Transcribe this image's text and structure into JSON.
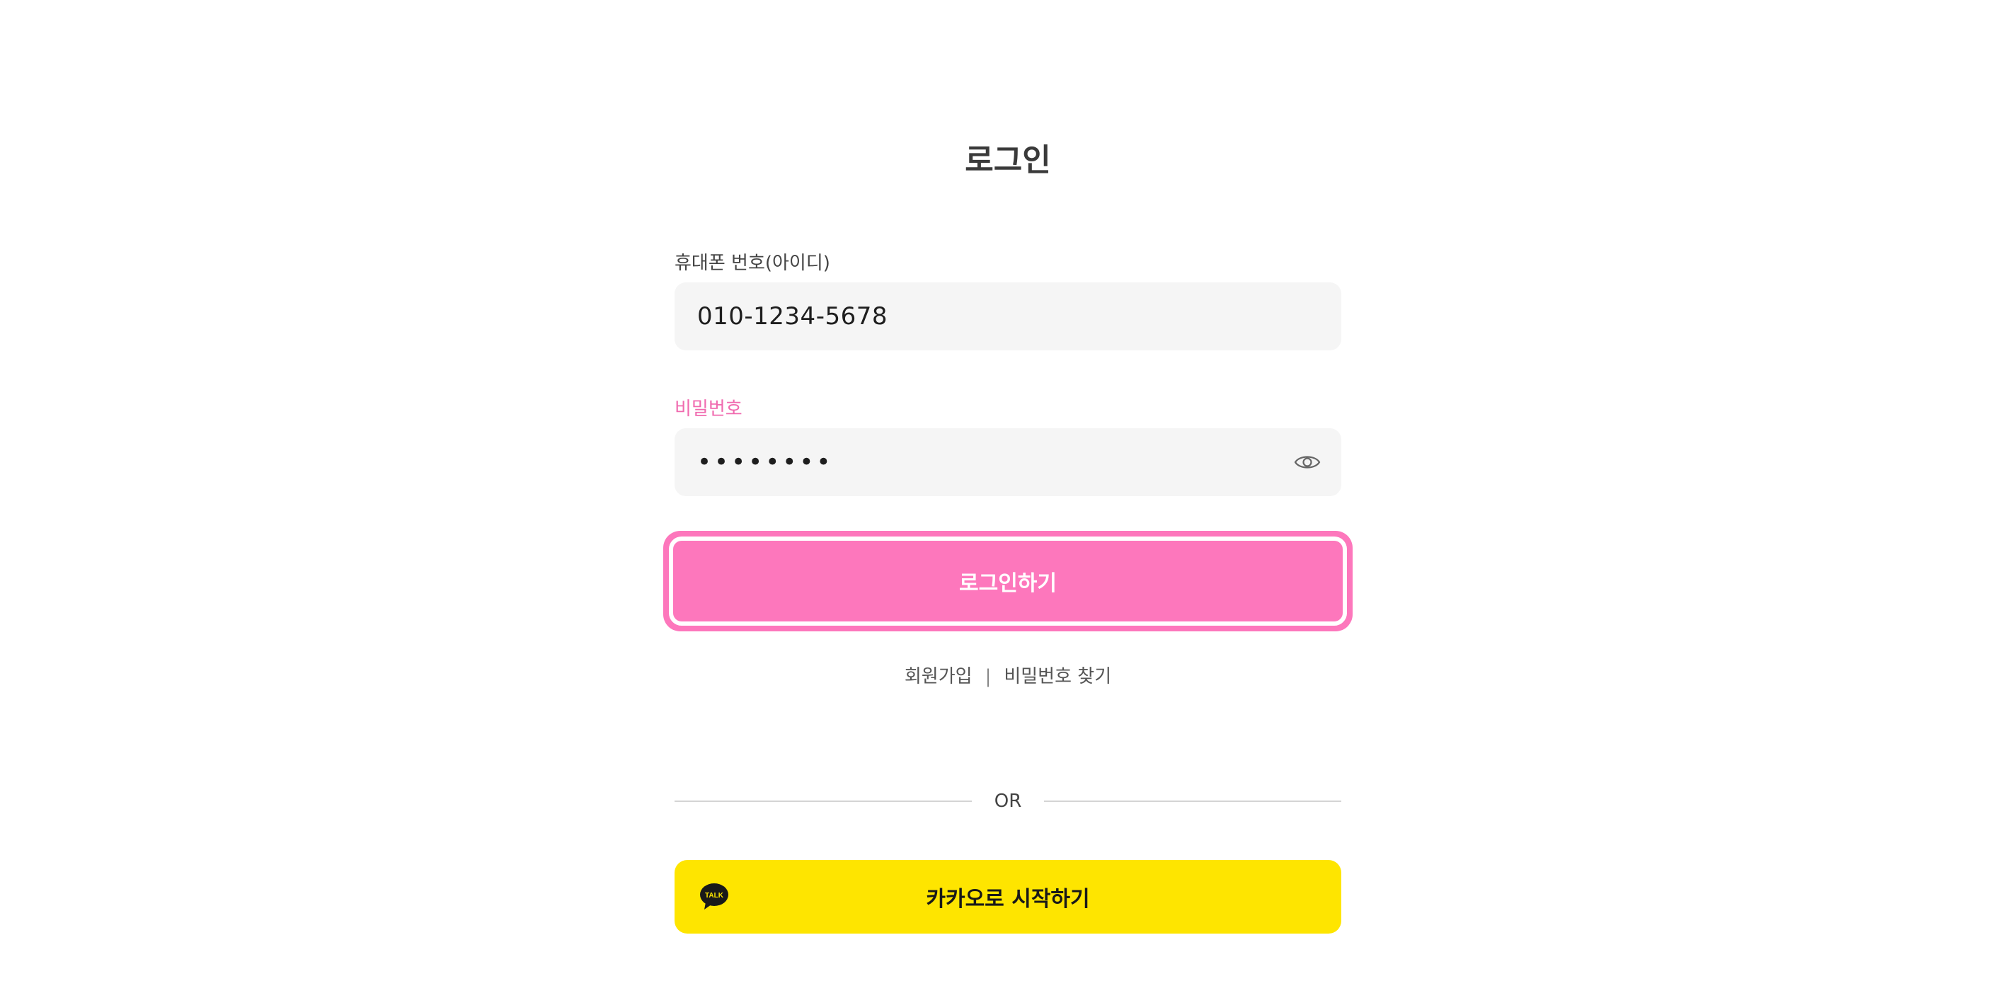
{
  "page_title": "로그인",
  "phone_field": {
    "label": "휴대폰 번호(아이디)",
    "value": "010-1234-5678"
  },
  "password_field": {
    "label": "비밀번호",
    "masked_value": "••••••••"
  },
  "login_button": {
    "label": "로그인하기"
  },
  "links": {
    "signup": "회원가입",
    "separator": "|",
    "find_password": "비밀번호 찾기"
  },
  "divider": {
    "text": "OR"
  },
  "kakao_button": {
    "label": "카카오로 시작하기",
    "icon_text": "TALK"
  },
  "colors": {
    "accent_pink": "#fd77bc",
    "label_pink": "#f06aaf",
    "kakao_yellow": "#fee500",
    "input_bg": "#f5f5f5"
  }
}
